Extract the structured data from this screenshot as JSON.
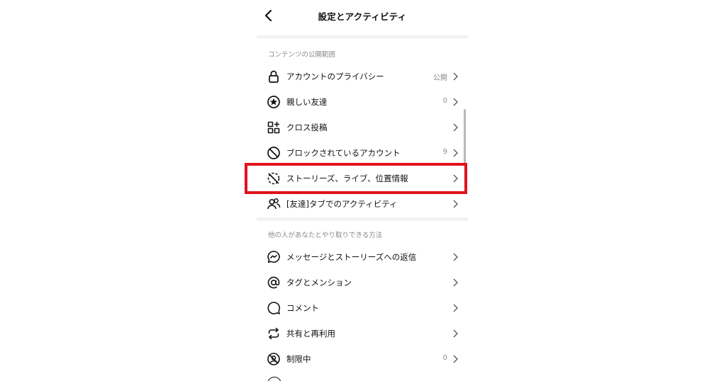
{
  "header": {
    "title": "設定とアクティビティ"
  },
  "sections": [
    {
      "heading": "コンテンツの公開範囲",
      "items": [
        {
          "label": "アカウントのプライバシー",
          "value": "公開",
          "icon": "lock-icon"
        },
        {
          "label": "親しい友達",
          "value": "0",
          "icon": "star-circle-icon"
        },
        {
          "label": "クロス投稿",
          "value": "",
          "icon": "grid-plus-icon"
        },
        {
          "label": "ブロックされているアカウント",
          "value": "9",
          "icon": "block-icon"
        },
        {
          "label": "ストーリーズ、ライブ、位置情報",
          "value": "",
          "icon": "hidden-story-icon"
        },
        {
          "label": "[友達]タブでのアクティビティ",
          "value": "",
          "icon": "people-icon"
        }
      ]
    },
    {
      "heading": "他の人があなたとやり取りできる方法",
      "items": [
        {
          "label": "メッセージとストーリーズへの返信",
          "value": "",
          "icon": "messenger-icon"
        },
        {
          "label": "タグとメンション",
          "value": "",
          "icon": "at-sign-icon"
        },
        {
          "label": "コメント",
          "value": "",
          "icon": "comment-icon"
        },
        {
          "label": "共有と再利用",
          "value": "",
          "icon": "repost-icon"
        },
        {
          "label": "制限中",
          "value": "0",
          "icon": "restricted-icon"
        }
      ]
    }
  ],
  "colors": {
    "highlight": "#e0131b",
    "secondary_text": "#8a8a8a"
  }
}
